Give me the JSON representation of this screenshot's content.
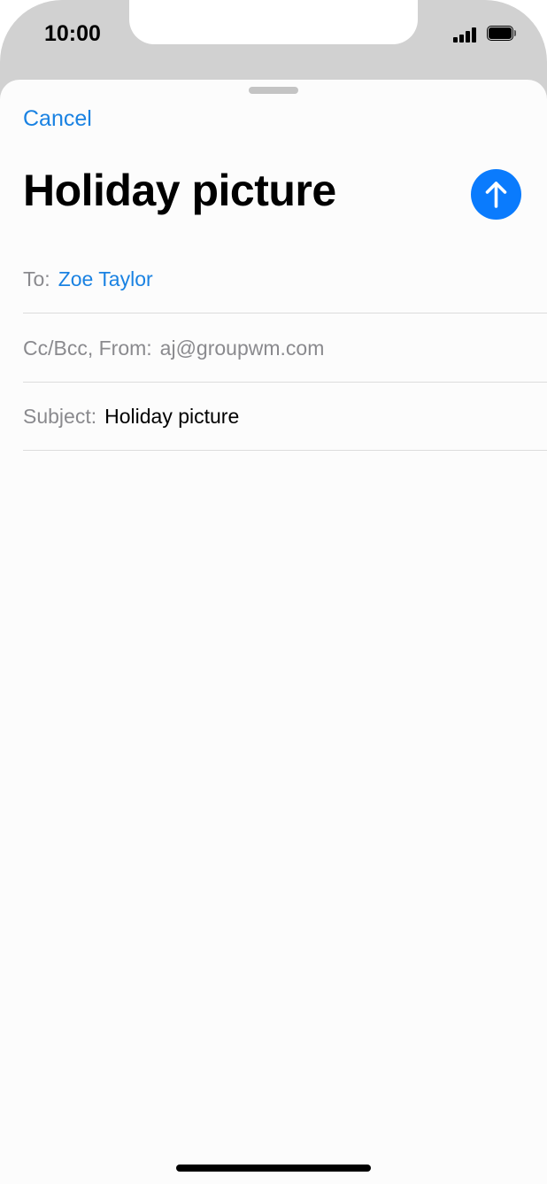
{
  "status_bar": {
    "time": "10:00",
    "signal_icon": "cellular-signal-icon",
    "battery_icon": "battery-icon",
    "battery_level": 1.0
  },
  "compose": {
    "cancel_label": "Cancel",
    "title": "Holiday picture",
    "send_icon": "arrow-up-icon",
    "accent_color": "#0a7bfd",
    "to_label": "To:",
    "to_value": "Zoe Taylor",
    "cc_from_label": "Cc/Bcc, From:",
    "from_value": "aj@groupwm.com",
    "subject_label": "Subject:",
    "subject_value": "Holiday picture"
  }
}
